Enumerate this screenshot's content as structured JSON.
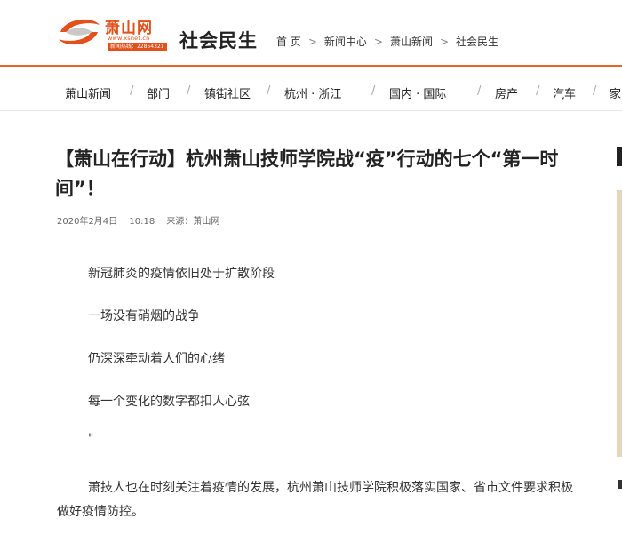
{
  "header": {
    "logo": {
      "name": "萧山网",
      "url": "www.xsnet.cn",
      "phone": "新闻热线：22854321"
    },
    "section_title": "社会民生",
    "breadcrumb": [
      "首 页",
      "新闻中心",
      "萧山新闻",
      "社会民生"
    ]
  },
  "nav": {
    "items": [
      "萧山新闻",
      "部门",
      "镇街社区",
      "杭州 · 浙江",
      "国内 · 国际",
      "房产",
      "汽车",
      "家"
    ]
  },
  "article": {
    "title": "【萧山在行动】杭州萧山技师学院战“疫”行动的七个“第一时间”！",
    "date": "2020年2月4日",
    "time": "10:18",
    "source": "来源：萧山网",
    "lines": [
      "新冠肺炎的疫情依旧处于扩散阶段",
      "一场没有硝烟的战争",
      "仍深深牵动着人们的心绪",
      "每一个变化的数字都扣人心弦",
      "\""
    ],
    "body": "萧技人也在时刻关注着疫情的发展，杭州萧山技师学院积极落实国家、省市文件要求积极做好疫情防控。"
  },
  "colors": {
    "accent": "#e8652a"
  }
}
